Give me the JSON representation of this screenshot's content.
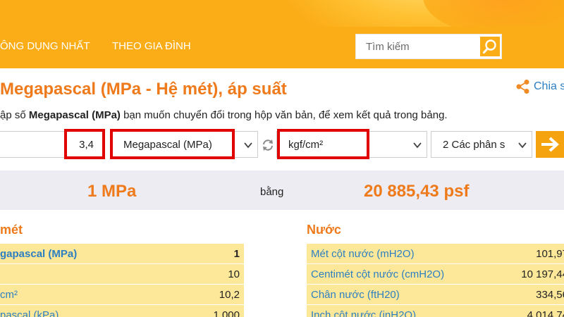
{
  "nav": {
    "items": [
      {
        "label": "ÔNG DỤNG NHẤT"
      },
      {
        "label": "THEO GIA ĐÌNH"
      }
    ]
  },
  "search": {
    "placeholder": "Tìm kiếm",
    "icon": "search-icon"
  },
  "page": {
    "title": "Megapascal (MPa - Hệ mét), áp suất",
    "share_label": "Chia s",
    "instruction_prefix": "ập số ",
    "instruction_unit": "Megapascal (MPa)",
    "instruction_suffix": " bạn muốn chuyển đổi trong hộp văn bản, để xem kết quả trong bảng."
  },
  "converter": {
    "input_value": "3,4",
    "from_unit": "Megapascal (MPa)",
    "to_unit": "kgf/cm²",
    "precision": "2 Các phân s"
  },
  "result": {
    "from": "1 MPa",
    "equals": "bằng",
    "to": "20 885,43 psf"
  },
  "colors": {
    "brand_orange": "#fbad18",
    "title_orange": "#ee7a1c",
    "link_blue": "#2d7fc1",
    "row_yellow": "#fde89a",
    "highlight_red": "#e00000"
  },
  "tables": {
    "left": {
      "title": "mét",
      "rows": [
        {
          "name": "gapascal (MPa)",
          "value": "1"
        },
        {
          "name": "",
          "value": "10"
        },
        {
          "name": "cm²",
          "value": "10,2"
        },
        {
          "name": "pascal (kPa)",
          "value": "1 000"
        }
      ]
    },
    "right": {
      "title": "Nước",
      "rows": [
        {
          "name": "Mét cột nước (mH2O)",
          "value": "101,97"
        },
        {
          "name": "Centimét cột nước (cmH2O)",
          "value": "10 197,44"
        },
        {
          "name": "Chân nước (ftH20)",
          "value": "334,56"
        },
        {
          "name": "Inch cột nước (inH2O)",
          "value": "4 014,74"
        }
      ]
    }
  }
}
